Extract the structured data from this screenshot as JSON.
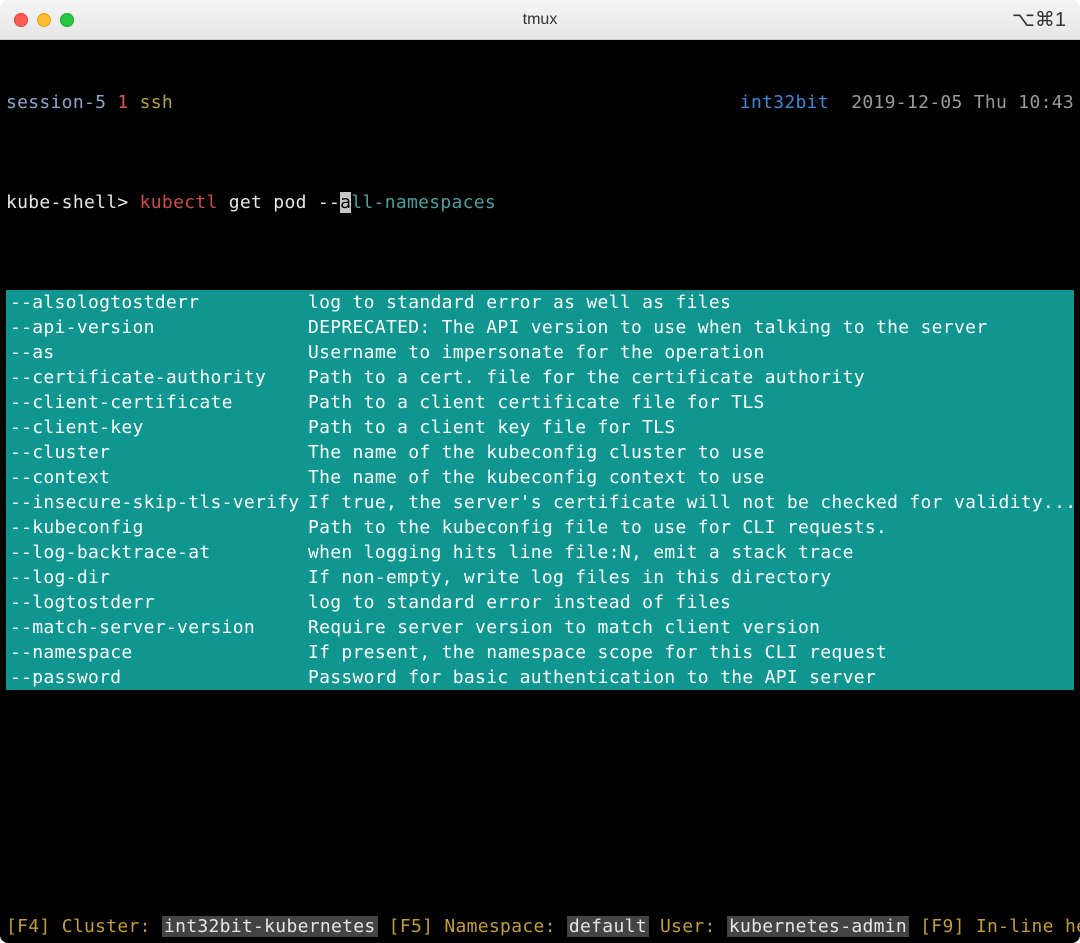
{
  "titlebar": {
    "title": "tmux",
    "shortcut": "⌥⌘1"
  },
  "tmux": {
    "session_label": "session-5",
    "win_index": "1",
    "win_name": "ssh",
    "host": "int32bit",
    "datetime": "2019-12-05 Thu 10:43"
  },
  "prompt": {
    "ps": "kube-shell> ",
    "cmd": "kubectl",
    "args_pre": " get pod --",
    "cursor_ch": "a",
    "suffix": "ll-namespaces"
  },
  "popup": {
    "rows": [
      {
        "flag": "--alsologtostderr",
        "desc": "log to standard error as well as files"
      },
      {
        "flag": "--api-version",
        "desc": "DEPRECATED: The API version to use when talking to the server"
      },
      {
        "flag": "--as",
        "desc": "Username to impersonate for the operation"
      },
      {
        "flag": "--certificate-authority",
        "desc": "Path to a cert. file for the certificate authority"
      },
      {
        "flag": "--client-certificate",
        "desc": "Path to a client certificate file for TLS"
      },
      {
        "flag": "--client-key",
        "desc": "Path to a client key file for TLS"
      },
      {
        "flag": "--cluster",
        "desc": "The name of the kubeconfig cluster to use"
      },
      {
        "flag": "--context",
        "desc": "The name of the kubeconfig context to use"
      },
      {
        "flag": "--insecure-skip-tls-verify",
        "desc": "If true, the server's certificate will not be checked for validity..."
      },
      {
        "flag": "--kubeconfig",
        "desc": "Path to the kubeconfig file to use for CLI requests."
      },
      {
        "flag": "--log-backtrace-at",
        "desc": "when logging hits line file:N, emit a stack trace"
      },
      {
        "flag": "--log-dir",
        "desc": "If non-empty, write log files in this directory"
      },
      {
        "flag": "--logtostderr",
        "desc": "log to standard error instead of files"
      },
      {
        "flag": "--match-server-version",
        "desc": "Require server version to match client version"
      },
      {
        "flag": "--namespace",
        "desc": "If present, the namespace scope for this CLI request"
      },
      {
        "flag": "--password",
        "desc": "Password for basic authentication to the API server"
      }
    ]
  },
  "bottom": {
    "f4": "[F4]",
    "cluster_lbl": " Cluster: ",
    "cluster_val": "int32bit-kubernetes",
    "f5": " [F5]",
    "ns_lbl": " Namespace: ",
    "ns_val": "default",
    "user_lbl": " User: ",
    "user_val": "kubernetes-admin",
    "f9": " [F9]",
    "help_lbl": " In-line help:"
  }
}
